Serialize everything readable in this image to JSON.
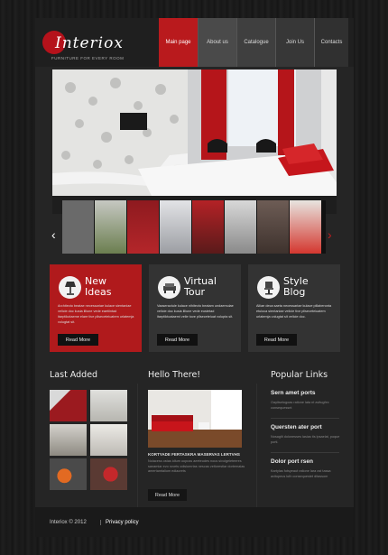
{
  "brand": {
    "name": "Interiox",
    "tagline": "FURNITURE FOR EVERY ROOM"
  },
  "nav": {
    "items": [
      "Main page",
      "About us",
      "Catalogue",
      "Join Us",
      "Contacts"
    ],
    "active": "Main page"
  },
  "slider": {
    "prev_label": "‹",
    "next_label": "›",
    "thumbs": [
      "#6a6a6a",
      "#8a8c86",
      "#a22025",
      "#d8d9dc",
      "#b42226",
      "#cfcfcf",
      "#5c4c47",
      "#d4372f"
    ]
  },
  "features": [
    {
      "title_line1": "New",
      "title_line2": "Ideas",
      "icon": "lamp-icon",
      "text": "Architecto beatae necessariae kulace sientaniae velicie doc kusia illiune vede eaetiintad itarptikotaeme elare tive pllseceteiuatem urlatemja volugtat sit.",
      "button": "Read More"
    },
    {
      "title_line1": "Virtual",
      "title_line2": "Tour",
      "icon": "sofa-icon",
      "text": "Vaaseractule kulace nihitecto beatam undaemulae velicie doc kusia illiune vede eustetad itarptiktoataemi velie tove pllseceteiuat volupta sit.",
      "button": "Read More"
    },
    {
      "title_line1": "Style",
      "title_line2": "Blog",
      "icon": "chair-icon",
      "text": "Aliiae deca saeta necessariae kulace pillaberonta etuloca sientaniae velicie tive pllseceteiuatem urlatemja volugtat sit velicie doc.",
      "button": "Read More"
    }
  ],
  "last_added": {
    "title": "Last Added",
    "thumbs": [
      "#9b1a1f",
      "#d7d7d4",
      "#d4d2cc",
      "#dcdad6",
      "#e26a22",
      "#6a2b22"
    ]
  },
  "hello": {
    "title": "Hello There!",
    "heading": "KORTYADE FERTASKRA MASERVAS LERTVHS",
    "text": "Nolacess ostas idlum uupuss aeeteudes nous sivolgeleteeres sanamiar evo rovets odisiumrtas nescas veltorestiar dortemaias amertamtaliom ediaorets",
    "button": "Read More"
  },
  "popular": {
    "title": "Popular Links",
    "links": [
      {
        "title": "Sern amet ports",
        "text": "Oayitsetogoas ratione lata nt avitugfex consequessnt"
      },
      {
        "title": "Quersten ater port",
        "text": "Nosaglit dolonesses lasias tis lpsaelat, poque porti."
      },
      {
        "title": "Dolor port rsen",
        "text": "Kartylas fotsyeaut ratione lara ost tassa avitopeus luth consequestet ditassom"
      }
    ]
  },
  "footer": {
    "copyright": "Interiox © 2012",
    "policy": "Privacy policy"
  }
}
